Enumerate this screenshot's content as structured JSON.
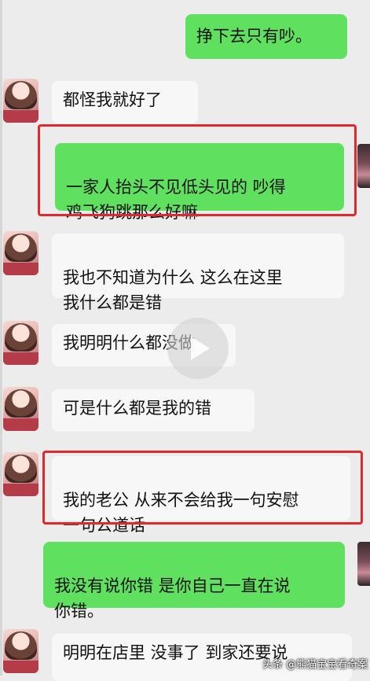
{
  "messages": [
    {
      "side": "right",
      "text": "挣下去只有吵。"
    },
    {
      "side": "left",
      "text": "都怪我就好了"
    },
    {
      "side": "right",
      "text": "一家人抬头不见低头见的 吵得\n鸡飞狗跳那么好嘛"
    },
    {
      "side": "left",
      "text": "我也不知道为什么 这么在这里\n我什么都是错"
    },
    {
      "side": "left",
      "text": "我明明什么都没做"
    },
    {
      "side": "left",
      "text": "可是什么都是我的错"
    },
    {
      "side": "left",
      "text": "我的老公 从来不会给我一句安慰\n一句公道话"
    },
    {
      "side": "right",
      "text": "我没有说你错 是你自己一直在说\n你错。"
    },
    {
      "side": "left",
      "text": "明明在店里 没事了 到家还要说"
    }
  ],
  "watermark": "头条 @熊猫宝宝看奇案",
  "colors": {
    "green": "#5fe05f",
    "highlight": "#e0282e"
  }
}
